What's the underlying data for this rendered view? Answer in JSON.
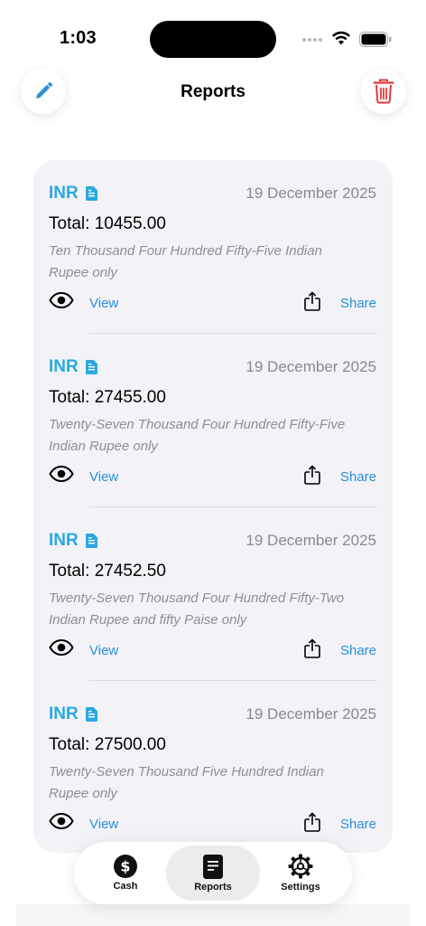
{
  "status": {
    "time": "1:03"
  },
  "header": {
    "title": "Reports"
  },
  "reports": [
    {
      "currency": "INR",
      "date": "19 December 2025",
      "total": "Total: 10455.00",
      "words": "Ten Thousand Four Hundred Fifty-Five Indian Rupee only",
      "view": "View",
      "share": "Share"
    },
    {
      "currency": "INR",
      "date": "19 December 2025",
      "total": "Total: 27455.00",
      "words": "Twenty-Seven Thousand Four Hundred Fifty-Five Indian Rupee only",
      "view": "View",
      "share": "Share"
    },
    {
      "currency": "INR",
      "date": "19 December 2025",
      "total": "Total: 27452.50",
      "words": "Twenty-Seven Thousand Four Hundred Fifty-Two Indian Rupee and fifty Paise only",
      "view": "View",
      "share": "Share"
    },
    {
      "currency": "INR",
      "date": "19 December 2025",
      "total": "Total: 27500.00",
      "words": "Twenty-Seven Thousand Five Hundred Indian Rupee only",
      "view": "View",
      "share": "Share"
    }
  ],
  "tabs": [
    {
      "label": "Cash",
      "icon": "dollar-icon"
    },
    {
      "label": "Reports",
      "icon": "document-icon",
      "selected": true
    },
    {
      "label": "Settings",
      "icon": "gear-icon"
    }
  ],
  "colors": {
    "accent": "#2aa8e0",
    "link": "#2b8fd8",
    "danger": "#e5383b",
    "card_bg": "#f2f2f7"
  }
}
